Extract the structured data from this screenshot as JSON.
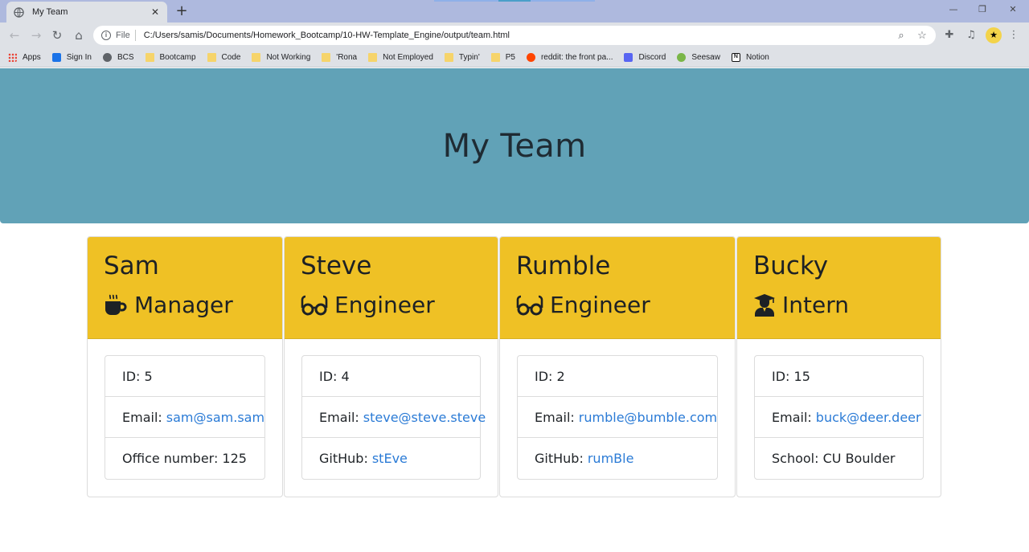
{
  "browser": {
    "tab_title": "My Team",
    "new_tab": "+",
    "url_scheme": "File",
    "url": "C:/Users/samis/Documents/Homework_Bootcamp/10-HW-Template_Engine/output/team.html",
    "bookmarks": [
      {
        "label": "Apps",
        "icon": "apps-icon"
      },
      {
        "label": "Sign In",
        "icon": "outlook-icon"
      },
      {
        "label": "BCS",
        "icon": "globe-icon"
      },
      {
        "label": "Bootcamp",
        "icon": "folder-icon"
      },
      {
        "label": "Code",
        "icon": "folder-icon"
      },
      {
        "label": "Not Working",
        "icon": "folder-icon"
      },
      {
        "label": "'Rona",
        "icon": "folder-icon"
      },
      {
        "label": "Not Employed",
        "icon": "folder-icon"
      },
      {
        "label": "Typin'",
        "icon": "folder-icon"
      },
      {
        "label": "P5",
        "icon": "folder-icon"
      },
      {
        "label": "reddit: the front pa...",
        "icon": "reddit-icon"
      },
      {
        "label": "Discord",
        "icon": "discord-icon"
      },
      {
        "label": "Seesaw",
        "icon": "seesaw-icon"
      },
      {
        "label": "Notion",
        "icon": "notion-icon"
      }
    ]
  },
  "page": {
    "title": "My Team",
    "header_color": "#61a2b7",
    "card_header_color": "#efc125",
    "link_color": "#2b7bd6"
  },
  "team": [
    {
      "name": "Sam",
      "role": "Manager",
      "role_icon": "coffee-icon",
      "id_label": "ID: 5",
      "email_label": "Email:",
      "email": "sam@sam.sam",
      "extra_label": "Office number: 125",
      "extra_link": ""
    },
    {
      "name": "Steve",
      "role": "Engineer",
      "role_icon": "glasses-icon",
      "id_label": "ID: 4",
      "email_label": "Email:",
      "email": "steve@steve.steve",
      "extra_label": "GitHub:",
      "extra_link": "stEve"
    },
    {
      "name": "Rumble",
      "role": "Engineer",
      "role_icon": "glasses-icon",
      "id_label": "ID: 2",
      "email_label": "Email:",
      "email": "rumble@bumble.com",
      "extra_label": "GitHub:",
      "extra_link": "rumBle"
    },
    {
      "name": "Bucky",
      "role": "Intern",
      "role_icon": "graduate-icon",
      "id_label": "ID: 15",
      "email_label": "Email:",
      "email": "buck@deer.deer",
      "extra_label": "School: CU Boulder",
      "extra_link": ""
    }
  ]
}
